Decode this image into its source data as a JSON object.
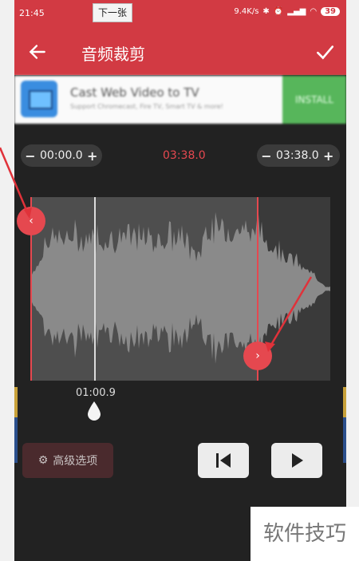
{
  "statusbar": {
    "time": "21:45",
    "net_speed": "9.4K/s",
    "battery": "39"
  },
  "overlay": {
    "next_label": "下一张"
  },
  "appbar": {
    "title": "音频裁剪",
    "back_icon": "arrow-left-icon",
    "confirm_icon": "check-icon"
  },
  "ad": {
    "title": "Cast Web Video to TV",
    "subtitle": "Support Chromecast, Fire TV, Smart TV & more!",
    "install_label": "INSTALL"
  },
  "trim": {
    "start_time": "00:00.0",
    "total_time": "03:38.0",
    "end_time": "03:38.0",
    "minus": "−",
    "plus": "+",
    "playhead_time": "01:00.9"
  },
  "controls": {
    "advanced_label": "高级选项"
  },
  "watermark": {
    "text": "软件技巧"
  },
  "colors": {
    "accent": "#d23a43",
    "handle": "#e5484f",
    "background": "#222222"
  }
}
